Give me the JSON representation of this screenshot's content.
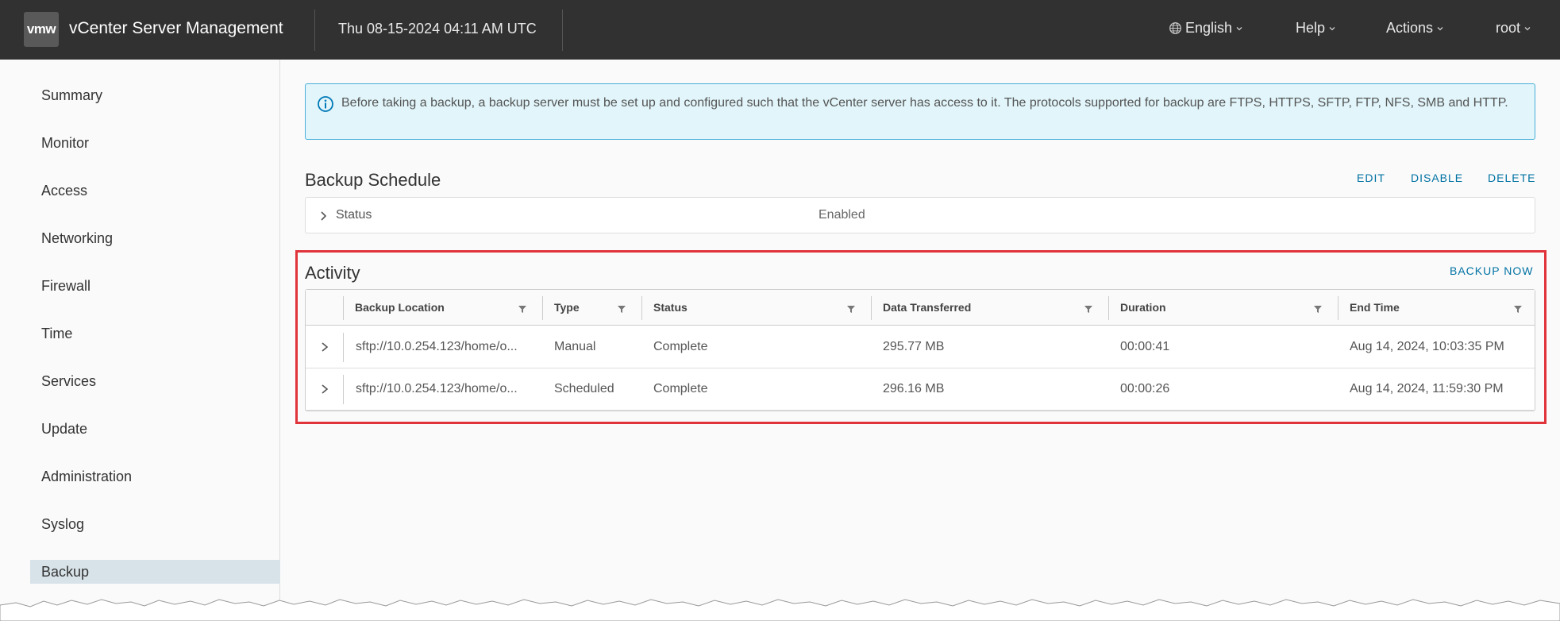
{
  "header": {
    "logo": "vmw",
    "title": "vCenter Server Management",
    "datetime": "Thu 08-15-2024 04:11 AM UTC",
    "language": "English",
    "help": "Help",
    "actions": "Actions",
    "user": "root"
  },
  "sidebar": {
    "items": [
      {
        "label": "Summary"
      },
      {
        "label": "Monitor"
      },
      {
        "label": "Access"
      },
      {
        "label": "Networking"
      },
      {
        "label": "Firewall"
      },
      {
        "label": "Time"
      },
      {
        "label": "Services"
      },
      {
        "label": "Update"
      },
      {
        "label": "Administration"
      },
      {
        "label": "Syslog"
      },
      {
        "label": "Backup",
        "active": true
      }
    ]
  },
  "info": {
    "icon": "info-circle-icon",
    "text": "Before taking a backup, a backup server must be set up and configured such that the vCenter server has access to it. The protocols supported for backup are FTPS, HTTPS, SFTP, FTP, NFS, SMB and HTTP."
  },
  "schedule": {
    "title": "Backup Schedule",
    "edit": "EDIT",
    "disable": "DISABLE",
    "delete": "DELETE",
    "status_label": "Status",
    "status_value": "Enabled"
  },
  "activity": {
    "title": "Activity",
    "backup_now": "BACKUP NOW",
    "columns": [
      "Backup Location",
      "Type",
      "Status",
      "Data Transferred",
      "Duration",
      "End Time"
    ],
    "rows": [
      {
        "location": "sftp://10.0.254.123/home/o...",
        "type": "Manual",
        "status": "Complete",
        "data": "295.77 MB",
        "duration": "00:00:41",
        "end": "Aug 14, 2024, 10:03:35 PM"
      },
      {
        "location": "sftp://10.0.254.123/home/o...",
        "type": "Scheduled",
        "status": "Complete",
        "data": "296.16 MB",
        "duration": "00:00:26",
        "end": "Aug 14, 2024, 11:59:30 PM"
      }
    ]
  },
  "colors": {
    "header_bg": "#313131",
    "link": "#0072a3",
    "info_bg": "#e1f5fa",
    "info_border": "#49afd9",
    "highlight": "#e0333a",
    "active_nav": "#d8e3e9"
  }
}
